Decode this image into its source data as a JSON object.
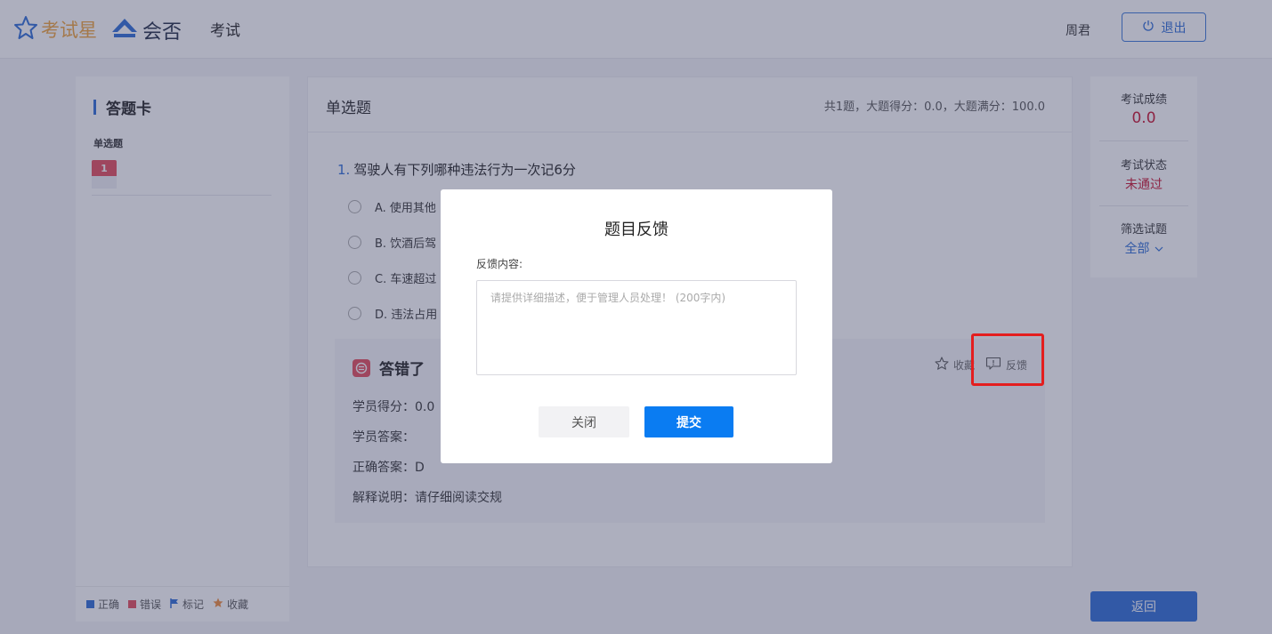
{
  "header": {
    "brand1": "考试星",
    "brand2": "会否",
    "title": "考试",
    "user": "周君",
    "logout": "退出"
  },
  "answer_card": {
    "title": "答题卡",
    "section": "单选题",
    "questions": [
      "1"
    ],
    "legend": [
      {
        "label": "正确",
        "color": "#2b6bd6"
      },
      {
        "label": "错误",
        "color": "#e54a5a"
      },
      {
        "label": "标记",
        "color": "#2b6bd6"
      },
      {
        "label": "收藏",
        "color": "#f08a3a"
      }
    ]
  },
  "main": {
    "section_title": "单选题",
    "summary": "共1题，大题得分：0.0，大题满分：100.0",
    "question": {
      "number": "1.",
      "text": "驾驶人有下列哪种违法行为一次记6分",
      "options": [
        "A. 使用其他",
        "B. 饮酒后驾",
        "C. 车速超过",
        "D. 违法占用"
      ]
    },
    "result": {
      "status": "答错了",
      "favorite": "收藏",
      "feedback": "反馈",
      "score_line": "学员得分：0.0",
      "answer_line": "学员答案：",
      "correct_line": "正确答案：D",
      "explain_line": "解释说明：请仔细阅读交规"
    }
  },
  "side": {
    "score_label": "考试成绩",
    "score_value": "0.0",
    "status_label": "考试状态",
    "status_value": "未通过",
    "filter_label": "筛选试题",
    "filter_value": "全部",
    "back": "返回"
  },
  "modal": {
    "title": "题目反馈",
    "label": "反馈内容:",
    "placeholder": "请提供详细描述，便于管理人员处理！ (200字内)",
    "close": "关闭",
    "submit": "提交"
  },
  "colors": {
    "accent": "#2b6bd6",
    "error": "#e54a5a",
    "submit": "#0a7cf2",
    "highlight": "#e41e1e"
  }
}
